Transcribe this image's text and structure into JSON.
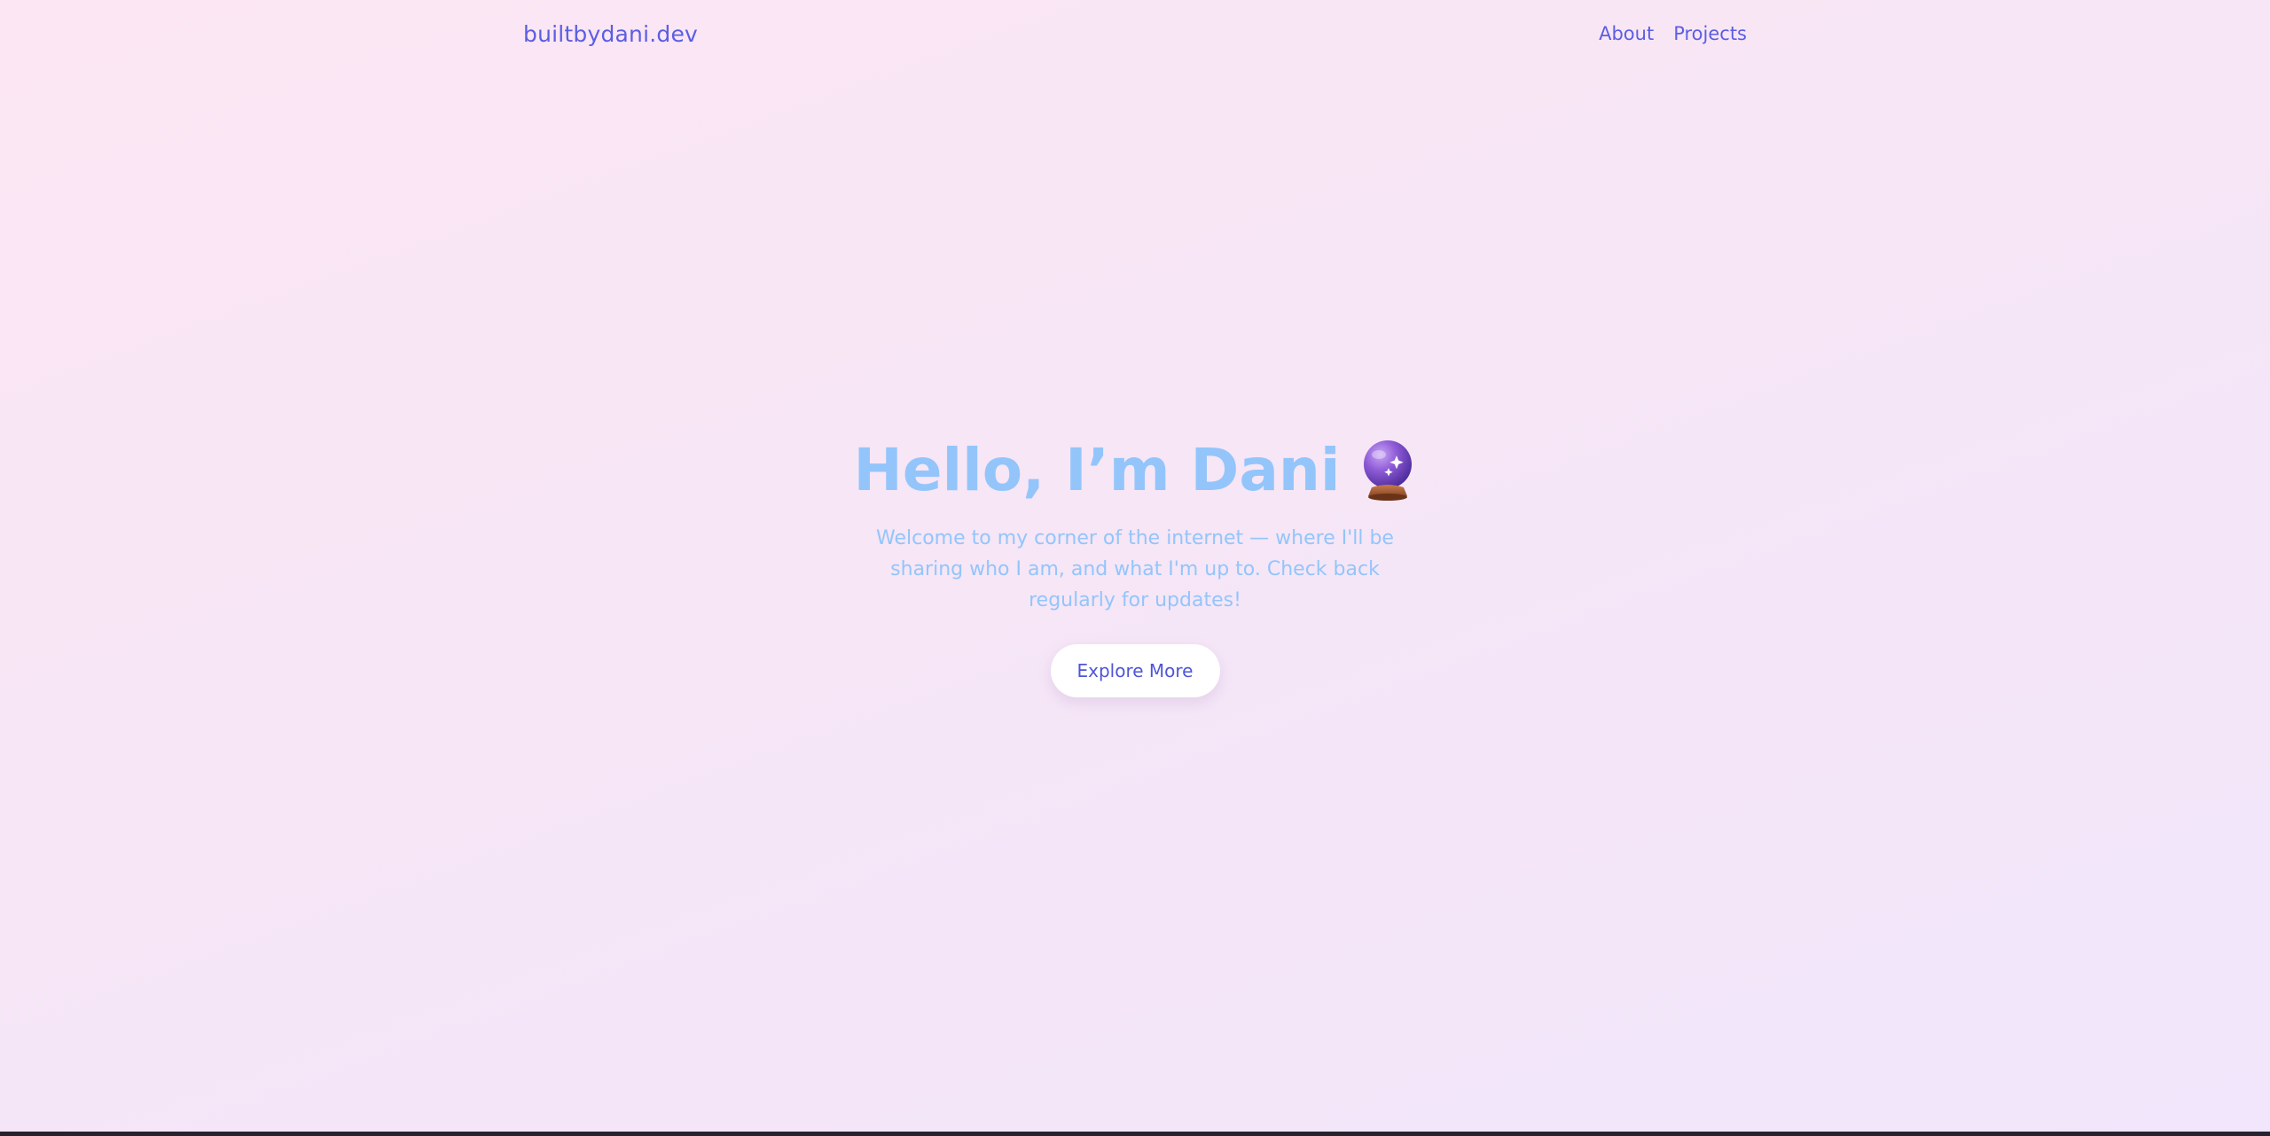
{
  "header": {
    "brand": "builtbydani.dev",
    "nav": [
      {
        "label": "About"
      },
      {
        "label": "Projects"
      }
    ]
  },
  "hero": {
    "title": "Hello, I’m Dani",
    "title_icon": "crystal-ball-icon",
    "subtitle": "Welcome to my corner of the internet — where I'll be sharing who I am, and what I'm up to. Check back regularly for updates!",
    "cta_label": "Explore More"
  },
  "colors": {
    "accent": "#5b5ee3",
    "hero_text": "#93c5fb",
    "background_start": "#fce6f3",
    "background_end": "#f1e6fb"
  }
}
